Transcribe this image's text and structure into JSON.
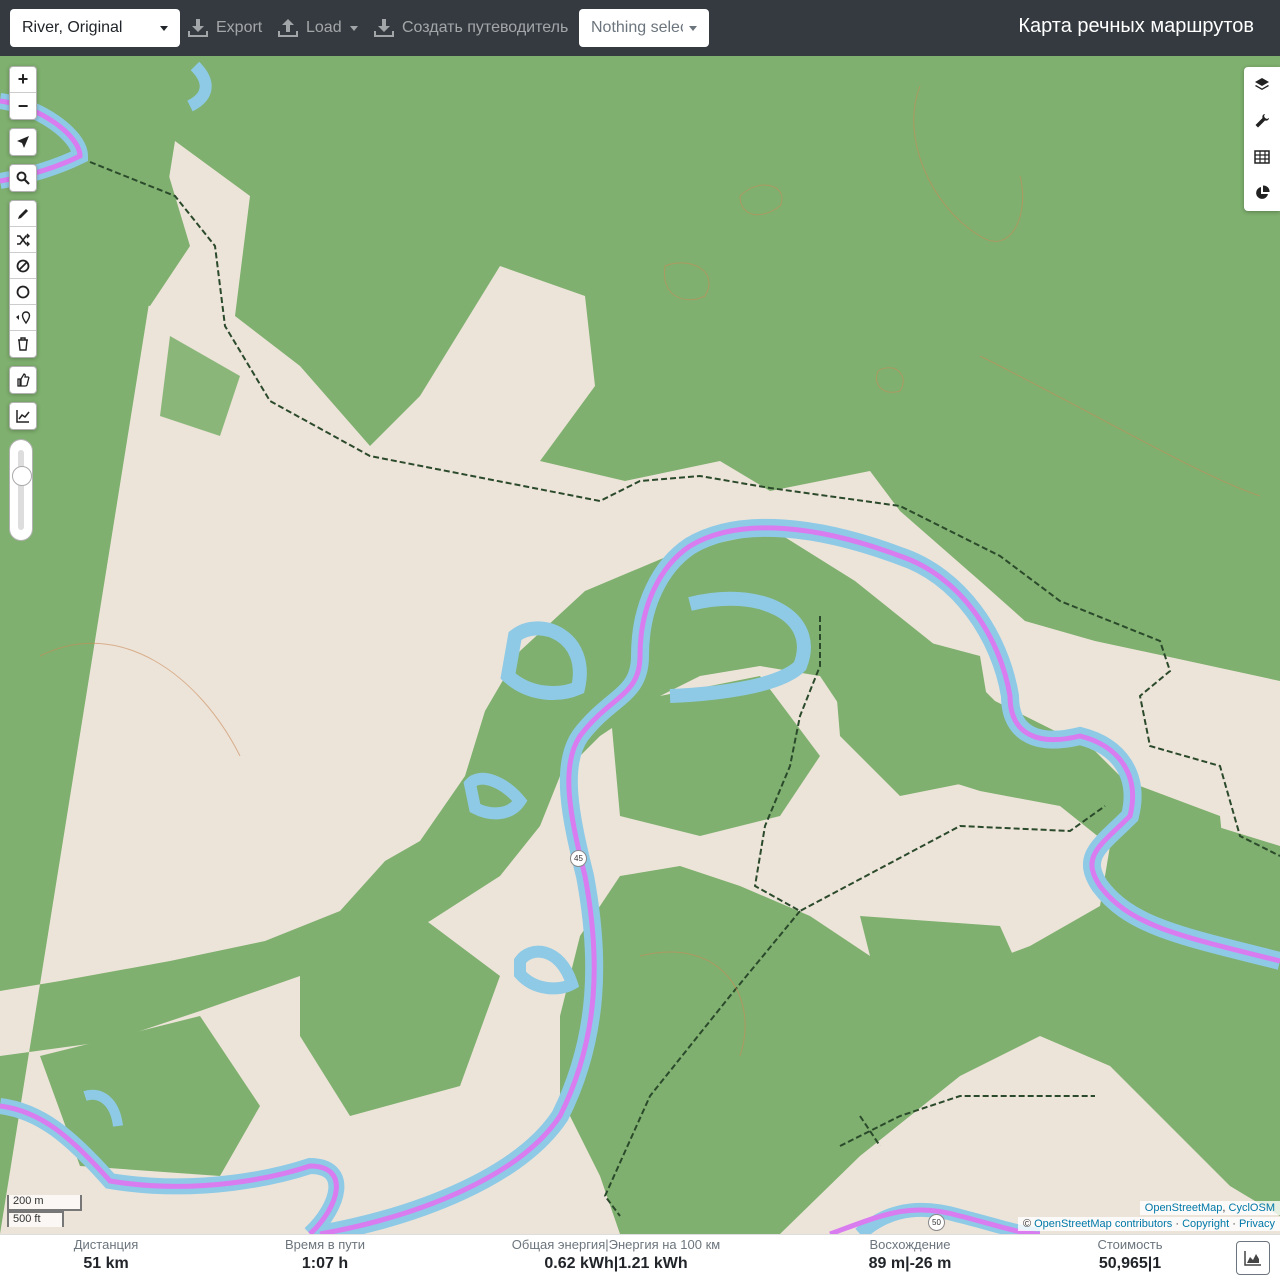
{
  "topbar": {
    "profile": "River, Original",
    "export_label": "Export",
    "load_label": "Load",
    "guide_label": "Создать путеводитель",
    "nothing_selected": "Nothing selected",
    "app_title": "Карта речных маршрутов"
  },
  "map": {
    "scale_metric": "200 m",
    "scale_imperial": "500 ft",
    "attribution_top": {
      "osm": "OpenStreetMap",
      "sep": ", ",
      "cyclosm": "CyclOSM"
    },
    "attribution_bottom": {
      "copy": "© ",
      "contributors": "OpenStreetMap contributors",
      "sep1": " · ",
      "copyright": "Copyright",
      "sep2": " · ",
      "privacy": "Privacy"
    },
    "route_badges": [
      "45",
      "50"
    ],
    "colors": {
      "forest": "#7fb06f",
      "clearing": "#ede4d9",
      "river": "#8ecae6",
      "route": "#d97cf0",
      "track": "#2b4a2b"
    }
  },
  "stats": {
    "distance": {
      "label": "Дистанция",
      "value": "51",
      "unit": "km"
    },
    "time": {
      "label": "Время в пути",
      "value": "1:07",
      "unit": "h"
    },
    "energy": {
      "label": "Общая энергия|Энергия на 100 км",
      "value1": "0.62",
      "unit1": "kWh",
      "sep": "|",
      "value2": "1.21",
      "unit2": "kWh"
    },
    "ascent": {
      "label": "Восхождение",
      "value1": "89",
      "unit1": "m",
      "sep": "|",
      "value2": "-26",
      "unit2": "m"
    },
    "cost": {
      "label": "Стоимость",
      "value1": "50,965",
      "sep": "|",
      "value2": "1"
    }
  }
}
